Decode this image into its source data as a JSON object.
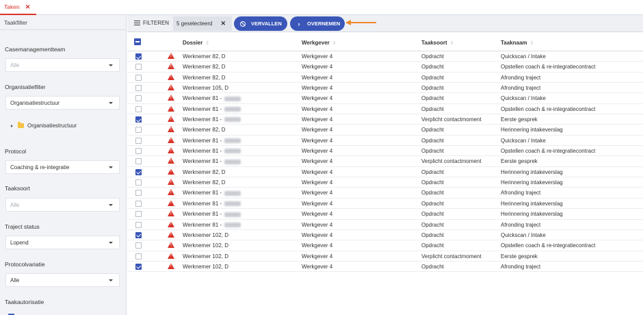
{
  "tab": {
    "label": "Taken",
    "close": "✕"
  },
  "sidebar": {
    "header": "Taakfilter",
    "casemanagementteam": {
      "label": "Casemanagementteam",
      "placeholder": "Alle"
    },
    "organisatiefilter": {
      "label": "Organisatiefilter",
      "value": "Organisatiestructuur",
      "tree_item": "Organisatiestructuur"
    },
    "protocol": {
      "label": "Protocol",
      "value": "Coaching & re-integratie"
    },
    "taaksoort": {
      "label": "Taaksoort",
      "placeholder": "Alle"
    },
    "traject_status": {
      "label": "Traject status",
      "value": "Lopend"
    },
    "protocolvariatie": {
      "label": "Protocolvariatie",
      "value": "Alle"
    },
    "taakautorisatie": {
      "label": "Taakautorisatie"
    }
  },
  "toolbar": {
    "filter_label": "FILTEREN",
    "selected_label": "5 geselecteerd",
    "selected_clear": "✕",
    "vervallen_label": "VERVALLEN",
    "overnemen_label": "OVERNEMEN"
  },
  "colors": {
    "accent": "#3a56b8",
    "warning": "#d9342b",
    "arrow": "#f0882b",
    "sidebar_bg": "#f2f3f6"
  },
  "table": {
    "columns": {
      "dossier": "Dossier",
      "werkgever": "Werkgever",
      "taaksoort": "Taaksoort",
      "taaknaam": "Taaknaam"
    },
    "sort_icon": "⇕",
    "rows": [
      {
        "checked": true,
        "dossier": "Werknemer 82, D",
        "blurred": false,
        "werkgever": "Werkgever 4",
        "taaksoort": "Opdracht",
        "taaknaam": "Quickscan / Intake"
      },
      {
        "checked": false,
        "dossier": "Werknemer 82, D",
        "blurred": false,
        "werkgever": "Werkgever 4",
        "taaksoort": "Opdracht",
        "taaknaam": "Opstellen coach & re-integratiecontract"
      },
      {
        "checked": false,
        "dossier": "Werknemer 82, D",
        "blurred": false,
        "werkgever": "Werkgever 4",
        "taaksoort": "Opdracht",
        "taaknaam": "Afronding traject"
      },
      {
        "checked": false,
        "dossier": "Werknemer 105, D",
        "blurred": false,
        "werkgever": "Werkgever 4",
        "taaksoort": "Opdracht",
        "taaknaam": "Afronding traject"
      },
      {
        "checked": false,
        "dossier": "Werknemer 81 -",
        "blurred": true,
        "werkgever": "Werkgever 4",
        "taaksoort": "Opdracht",
        "taaknaam": "Quickscan / Intake"
      },
      {
        "checked": false,
        "dossier": "Werknemer 81 -",
        "blurred": true,
        "werkgever": "Werkgever 4",
        "taaksoort": "Opdracht",
        "taaknaam": "Opstellen coach & re-integratiecontract"
      },
      {
        "checked": true,
        "dossier": "Werknemer 81 -",
        "blurred": true,
        "werkgever": "Werkgever 4",
        "taaksoort": "Verplicht contactmoment",
        "taaknaam": "Eerste gesprek"
      },
      {
        "checked": false,
        "dossier": "Werknemer 82, D",
        "blurred": false,
        "werkgever": "Werkgever 4",
        "taaksoort": "Opdracht",
        "taaknaam": "Herinnering intakeverslag"
      },
      {
        "checked": false,
        "dossier": "Werknemer 81 -",
        "blurred": true,
        "werkgever": "Werkgever 4",
        "taaksoort": "Opdracht",
        "taaknaam": "Quickscan / Intake"
      },
      {
        "checked": false,
        "dossier": "Werknemer 81 -",
        "blurred": true,
        "werkgever": "Werkgever 4",
        "taaksoort": "Opdracht",
        "taaknaam": "Opstellen coach & re-integratiecontract"
      },
      {
        "checked": false,
        "dossier": "Werknemer 81 -",
        "blurred": true,
        "werkgever": "Werkgever 4",
        "taaksoort": "Verplicht contactmoment",
        "taaknaam": "Eerste gesprek"
      },
      {
        "checked": true,
        "dossier": "Werknemer 82, D",
        "blurred": false,
        "werkgever": "Werkgever 4",
        "taaksoort": "Opdracht",
        "taaknaam": "Herinnering intakeverslag"
      },
      {
        "checked": false,
        "dossier": "Werknemer 82, D",
        "blurred": false,
        "werkgever": "Werkgever 4",
        "taaksoort": "Opdracht",
        "taaknaam": "Herinnering intakeverslag"
      },
      {
        "checked": false,
        "dossier": "Werknemer 81 -",
        "blurred": true,
        "werkgever": "Werkgever 4",
        "taaksoort": "Opdracht",
        "taaknaam": "Afronding traject"
      },
      {
        "checked": false,
        "dossier": "Werknemer 81 -",
        "blurred": true,
        "werkgever": "Werkgever 4",
        "taaksoort": "Opdracht",
        "taaknaam": "Herinnering intakeverslag"
      },
      {
        "checked": false,
        "dossier": "Werknemer 81 -",
        "blurred": true,
        "werkgever": "Werkgever 4",
        "taaksoort": "Opdracht",
        "taaknaam": "Herinnering intakeverslag"
      },
      {
        "checked": false,
        "dossier": "Werknemer 81 -",
        "blurred": true,
        "werkgever": "Werkgever 4",
        "taaksoort": "Opdracht",
        "taaknaam": "Afronding traject"
      },
      {
        "checked": true,
        "dossier": "Werknemer 102, D",
        "blurred": false,
        "werkgever": "Werkgever 4",
        "taaksoort": "Opdracht",
        "taaknaam": "Quickscan / Intake"
      },
      {
        "checked": false,
        "dossier": "Werknemer 102, D",
        "blurred": false,
        "werkgever": "Werkgever 4",
        "taaksoort": "Opdracht",
        "taaknaam": "Opstellen coach & re-integratiecontract"
      },
      {
        "checked": false,
        "dossier": "Werknemer 102, D",
        "blurred": false,
        "werkgever": "Werkgever 4",
        "taaksoort": "Verplicht contactmoment",
        "taaknaam": "Eerste gesprek"
      },
      {
        "checked": true,
        "dossier": "Werknemer 102, D",
        "blurred": false,
        "werkgever": "Werkgever 4",
        "taaksoort": "Opdracht",
        "taaknaam": "Afronding traject"
      }
    ]
  }
}
